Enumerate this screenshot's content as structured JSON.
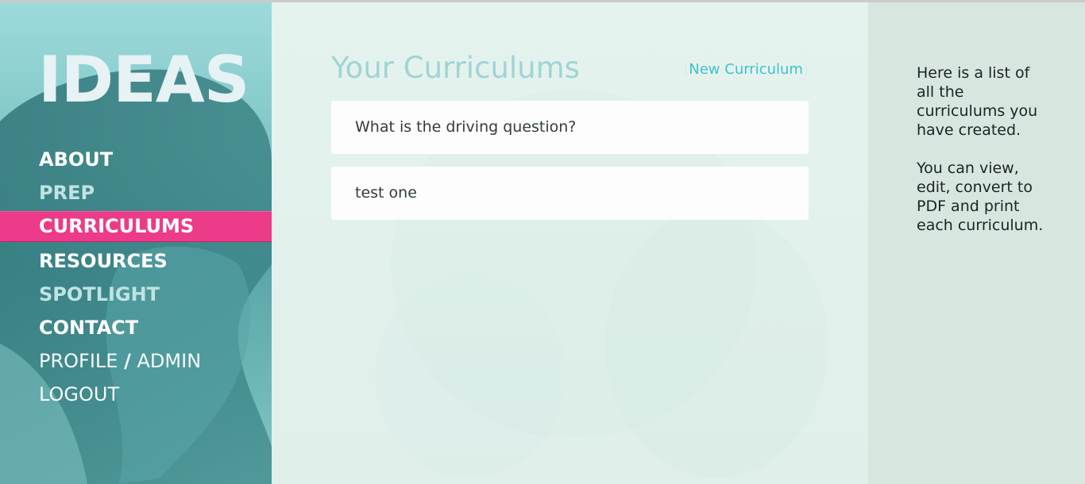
{
  "sidebar": {
    "logo": "IDEAS",
    "nav": {
      "about": "ABOUT",
      "prep": "PREP",
      "curriculums": "CURRICULUMS",
      "resources": "RESOURCES",
      "spotlight": "SPOTLIGHT",
      "contact": "CONTACT",
      "profile": "PROFILE",
      "slash": "/",
      "admin": "ADMIN",
      "logout": "LOGOUT"
    }
  },
  "main": {
    "title": "Your Curriculums",
    "new_link": {
      "open": "(",
      "label": "New Curriculum",
      "close": ")"
    },
    "curriculums": [
      "What is the driving question?",
      "test one"
    ]
  },
  "info": {
    "paragraph1": "Here is a list of all the curriculums you have created.",
    "paragraph2": "You can view, edit, convert to PDF and print each curriculum."
  },
  "colors": {
    "accent_pink": "#ec3b88",
    "teal_link": "#3dc2c9",
    "title_teal": "#9fd4d4"
  }
}
